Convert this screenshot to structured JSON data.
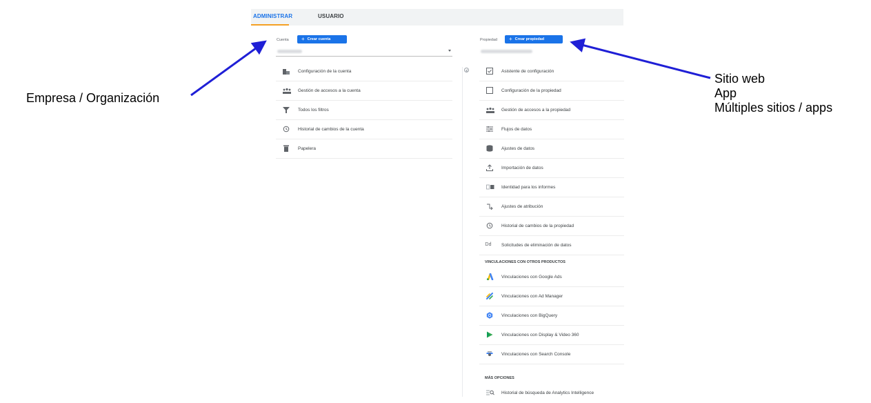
{
  "tabs": [
    {
      "label": "ADMINISTRAR",
      "active": true
    },
    {
      "label": "USUARIO",
      "active": false
    }
  ],
  "account": {
    "header_label": "Cuenta",
    "create_button": "Crear cuenta",
    "items": [
      {
        "icon": "building-icon",
        "label": "Configuración de la cuenta"
      },
      {
        "icon": "people-icon",
        "label": "Gestión de accesos a la cuenta"
      },
      {
        "icon": "filter-icon",
        "label": "Todos los filtros"
      },
      {
        "icon": "history-icon",
        "label": "Historial de cambios de la cuenta"
      },
      {
        "icon": "trash-icon",
        "label": "Papelera"
      }
    ]
  },
  "property": {
    "header_label": "Propiedad",
    "create_button": "Crear propiedad",
    "items": [
      {
        "icon": "checkbox-icon",
        "label": "Asistente de configuración"
      },
      {
        "icon": "square-icon",
        "label": "Configuración de la propiedad"
      },
      {
        "icon": "people-icon",
        "label": "Gestión de accesos a la propiedad"
      },
      {
        "icon": "data-streams-icon",
        "label": "Flujos de datos"
      },
      {
        "icon": "database-icon",
        "label": "Ajustes de datos"
      },
      {
        "icon": "upload-icon",
        "label": "Importación de datos"
      },
      {
        "icon": "identity-icon",
        "label": "Identidad para los informes"
      },
      {
        "icon": "attribution-icon",
        "label": "Ajustes de atribución"
      },
      {
        "icon": "history-icon",
        "label": "Historial de cambios de la propiedad"
      },
      {
        "icon": "dd-icon",
        "label": "Solicitudes de eliminación de datos"
      }
    ],
    "links_section": "VINCULACIONES CON OTROS PRODUCTOS",
    "links": [
      {
        "icon": "google-ads-icon",
        "label": "Vinculaciones con Google Ads"
      },
      {
        "icon": "ad-manager-icon",
        "label": "Vinculaciones con Ad Manager"
      },
      {
        "icon": "bigquery-icon",
        "label": "Vinculaciones con BigQuery"
      },
      {
        "icon": "display-video-icon",
        "label": "Vinculaciones con Display & Video 360"
      },
      {
        "icon": "search-console-icon",
        "label": "Vinculaciones con Search Console"
      }
    ],
    "more_section": "MÁS OPCIONES",
    "more": [
      {
        "icon": "search-history-icon",
        "label": "Historial de búsqueda de Analytics Intelligence"
      }
    ]
  },
  "annotations": {
    "left": "Empresa / Organización",
    "right": [
      "Sitio web",
      "App",
      "Múltiples sitios / apps"
    ]
  },
  "colors": {
    "accent": "#1a73e8",
    "tab_underline": "#f4a023",
    "arrow": "#1f1fd6"
  }
}
